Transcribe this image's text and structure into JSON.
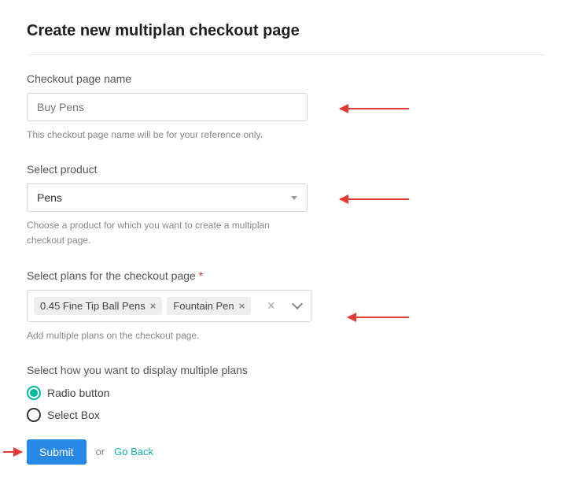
{
  "page": {
    "title": "Create new multiplan checkout page"
  },
  "fields": {
    "name": {
      "label": "Checkout page name",
      "value": "Buy Pens",
      "help": "This checkout page name will be for your reference only."
    },
    "product": {
      "label": "Select product",
      "value": "Pens",
      "help": "Choose a product for which you want to create a multiplan checkout page."
    },
    "plans": {
      "label": "Select plans for the checkout page",
      "required_mark": "*",
      "tags": [
        "0.45 Fine Tip Ball Pens",
        "Fountain Pen"
      ],
      "help": "Add multiple plans on the checkout page."
    },
    "display": {
      "label": "Select how you want to display multiple plans",
      "options": {
        "radio": "Radio button",
        "select": "Select Box"
      },
      "selected": "radio"
    }
  },
  "actions": {
    "submit": "Submit",
    "or": "or",
    "go_back": "Go Back"
  },
  "glyphs": {
    "x": "×"
  }
}
